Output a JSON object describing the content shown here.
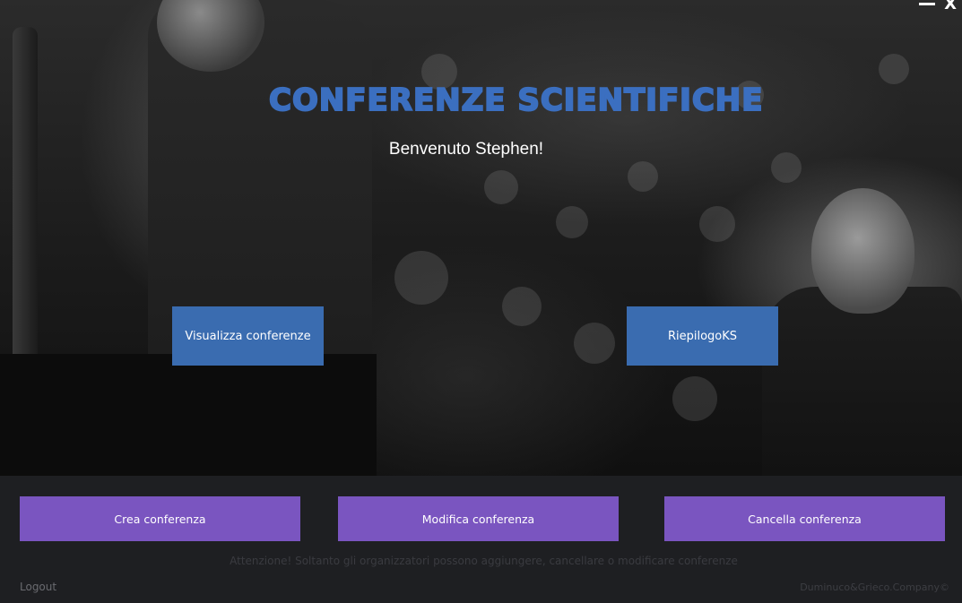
{
  "window": {
    "minimize_label": "",
    "close_label": "X"
  },
  "header": {
    "title": "Conferenze scientifiche",
    "welcome": "Benvenuto Stephen!"
  },
  "main": {
    "view_conferences_label": "Visualizza conferenze",
    "riepilogo_label": "RiepilogoKS"
  },
  "actions": {
    "create_label": "Crea conferenza",
    "edit_label": "Modifica conferenza",
    "delete_label": "Cancella conferenza"
  },
  "footer": {
    "warning": "Attenzione! Soltanto gli organizzatori possono aggiungere, cancellare o modificare conferenze",
    "logout_label": "Logout",
    "copyright": "Duminuco&Grieco.Company©"
  },
  "colors": {
    "title_blue": "#3b6fc0",
    "button_blue": "#3a6cb0",
    "button_purple": "#7a55c0",
    "panel_background": "#1e1f22"
  }
}
